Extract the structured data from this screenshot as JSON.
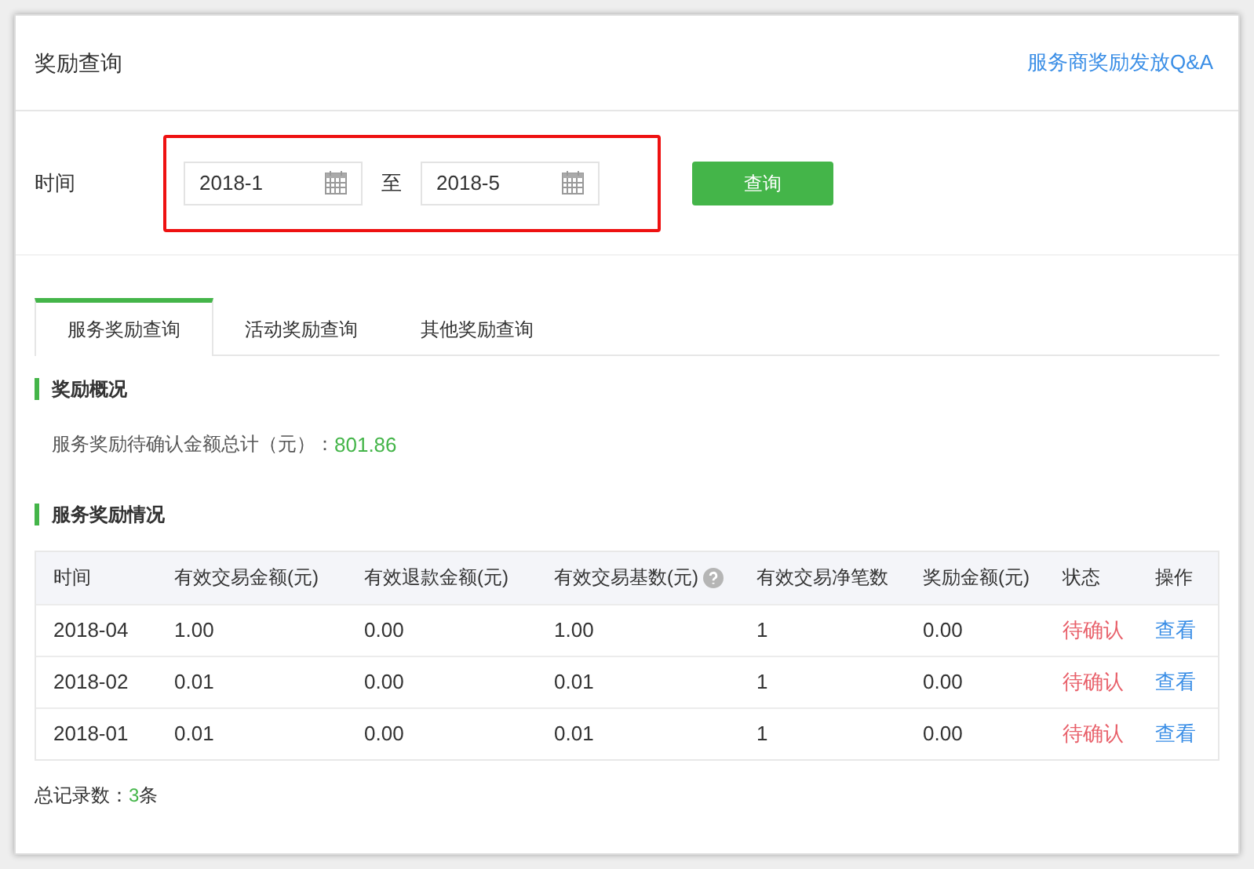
{
  "header": {
    "title": "奖励查询",
    "link": "服务商奖励发放Q&A"
  },
  "filter": {
    "label": "时间",
    "highlighted": true,
    "from": "2018-1",
    "separator": "至",
    "to": "2018-5",
    "button": "查询"
  },
  "tabs": [
    {
      "label": "服务奖励查询",
      "selected": true
    },
    {
      "label": "活动奖励查询",
      "selected": false
    },
    {
      "label": "其他奖励查询",
      "selected": false
    }
  ],
  "overview": {
    "heading": "奖励概况",
    "label": "服务奖励待确认金额总计（元）：",
    "amount": "801.86"
  },
  "details": {
    "heading": "服务奖励情况"
  },
  "table": {
    "columns": [
      {
        "label": "时间",
        "help": false
      },
      {
        "label": "有效交易金额(元)",
        "help": false
      },
      {
        "label": "有效退款金额(元)",
        "help": false
      },
      {
        "label": "有效交易基数(元)",
        "help": true
      },
      {
        "label": "有效交易净笔数",
        "help": false
      },
      {
        "label": "奖励金额(元)",
        "help": false
      },
      {
        "label": "状态",
        "help": false
      },
      {
        "label": "操作",
        "help": false
      }
    ],
    "rows": [
      {
        "cells": [
          "2018-04",
          "1.00",
          "0.00",
          "1.00",
          "1",
          "0.00"
        ],
        "status": "待确认",
        "action": "查看"
      },
      {
        "cells": [
          "2018-02",
          "0.01",
          "0.00",
          "0.01",
          "1",
          "0.00"
        ],
        "status": "待确认",
        "action": "查看"
      },
      {
        "cells": [
          "2018-01",
          "0.01",
          "0.00",
          "0.01",
          "1",
          "0.00"
        ],
        "status": "待确认",
        "action": "查看"
      }
    ]
  },
  "total": {
    "label": "总记录数：",
    "count": "3",
    "unit": "条"
  }
}
